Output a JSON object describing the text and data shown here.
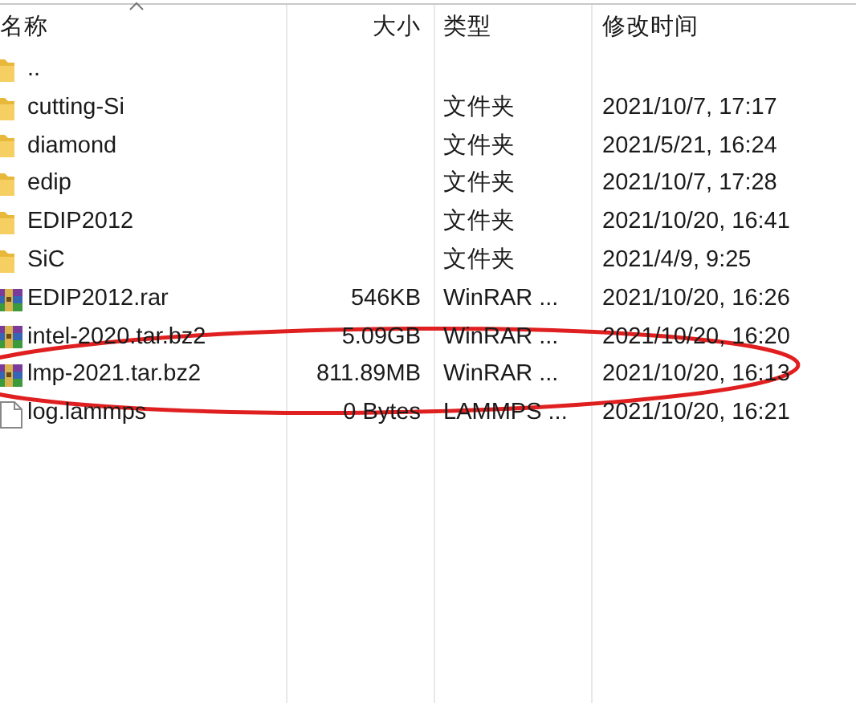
{
  "columns": [
    {
      "label": "名称",
      "sorted": true
    },
    {
      "label": "大小",
      "sorted": false
    },
    {
      "label": "类型",
      "sorted": false
    },
    {
      "label": "修改时间",
      "sorted": false
    }
  ],
  "rows": [
    {
      "kind": "folder",
      "name": "..",
      "size": "",
      "type": "",
      "modified": ""
    },
    {
      "kind": "folder",
      "name": "cutting-Si",
      "type": "文件夹",
      "modified": "2021/10/7, 17:17"
    },
    {
      "kind": "folder",
      "name": "diamond",
      "type": "文件夹",
      "modified": "2021/5/21, 16:24"
    },
    {
      "kind": "folder",
      "name": "edip",
      "type": "文件夹",
      "modified": "2021/10/7, 17:28"
    },
    {
      "kind": "folder",
      "name": "EDIP2012",
      "type": "文件夹",
      "modified": "2021/10/20, 16:41"
    },
    {
      "kind": "folder",
      "name": "SiC",
      "type": "文件夹",
      "modified": "2021/4/9, 9:25"
    },
    {
      "kind": "archive",
      "name": "EDIP2012.rar",
      "size": "546KB",
      "type": "WinRAR ...",
      "modified": "2021/10/20, 16:26"
    },
    {
      "kind": "archive",
      "name": "intel-2020.tar.bz2",
      "size": "5.09GB",
      "type": "WinRAR ...",
      "modified": "2021/10/20, 16:20"
    },
    {
      "kind": "archive",
      "name": "lmp-2021.tar.bz2",
      "size": "811.89MB",
      "type": "WinRAR ...",
      "modified": "2021/10/20, 16:13"
    },
    {
      "kind": "file",
      "name": "log.lammps",
      "size": "0 Bytes",
      "type": "LAMMPS ...",
      "modified": "2021/10/20, 16:21"
    }
  ],
  "annotation": {
    "kind": "ellipse",
    "color": "#e02020"
  }
}
